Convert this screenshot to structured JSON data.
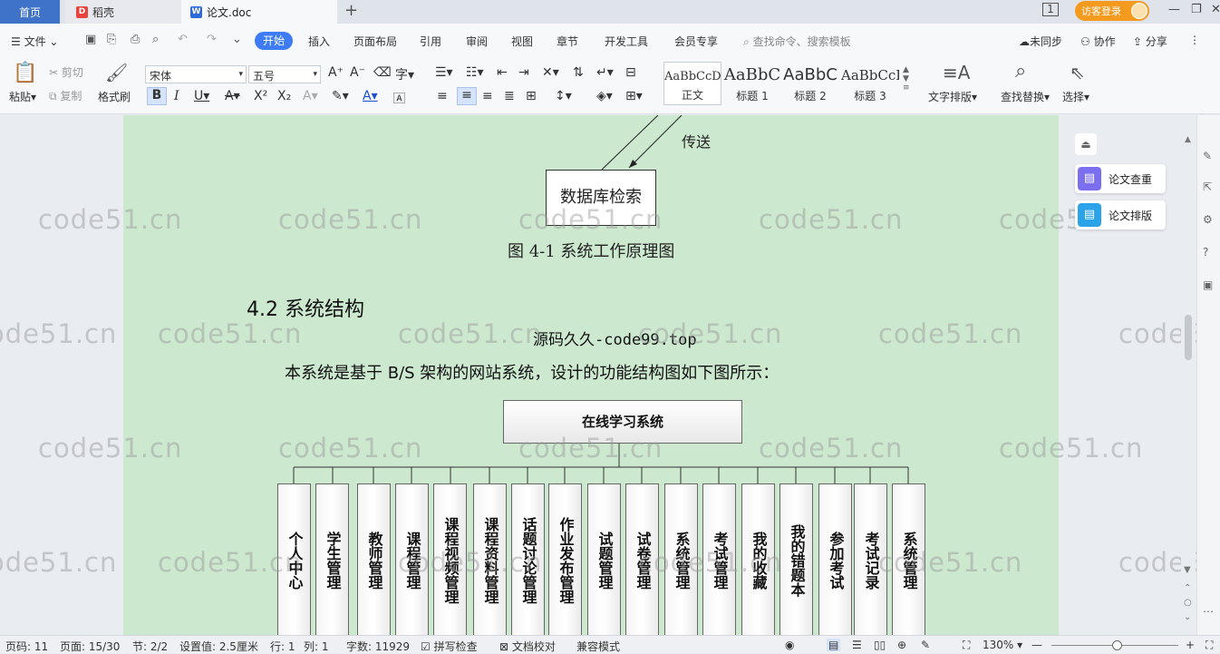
{
  "titlebar": {
    "tabs": [
      {
        "label": "首页"
      },
      {
        "label": "稻壳"
      },
      {
        "label": "论文.doc"
      }
    ],
    "login_label": "访客登录"
  },
  "menubar": {
    "file_label": "文件",
    "items": [
      "开始",
      "插入",
      "页面布局",
      "引用",
      "审阅",
      "视图",
      "章节",
      "开发工具",
      "会员专享"
    ],
    "search_placeholder": "查找命令、搜索模板",
    "sync_label": "未同步",
    "collab_label": "协作",
    "share_label": "分享"
  },
  "ribbon": {
    "paste_label": "粘贴",
    "cut_label": "剪切",
    "copy_label": "复制",
    "format_painter_label": "格式刷",
    "font_name": "宋体",
    "font_size": "五号",
    "styles": [
      {
        "preview": "AaBbCcDd",
        "label": "正文"
      },
      {
        "preview": "AaBbC",
        "label": "标题 1"
      },
      {
        "preview": "AaBbC",
        "label": "标题 2"
      },
      {
        "preview": "AaBbCcI",
        "label": "标题 3"
      }
    ],
    "text_layout_label": "文字排版",
    "find_replace_label": "查找替换",
    "select_label": "选择"
  },
  "document": {
    "transfer_label": "传送",
    "db_box_label": "数据库检索",
    "figure_caption": "图 4-1 系统工作原理图",
    "section_heading": "4.2 系统结构",
    "source_line": "源码久久-code99.top",
    "body_paragraph": "本系统是基于 B/S 架构的网站系统，设计的功能结构图如下图所示：",
    "root_module": "在线学习系统",
    "modules": [
      "个人中心",
      "学生管理",
      "教师管理",
      "课程管理",
      "课程视频管理",
      "课程资料管理",
      "话题讨论管理",
      "作业发布管理",
      "试题管理",
      "试卷管理",
      "系统管理",
      "考试管理",
      "我的收藏",
      "我的错题本",
      "参加考试",
      "考试记录",
      "系统管理"
    ],
    "watermark": "code51.cn"
  },
  "side_panels": [
    {
      "label": "论文查重",
      "color": "#7b6ff0"
    },
    {
      "label": "论文排版",
      "color": "#2aa3e8"
    }
  ],
  "statusbar": {
    "line_no": "页码: 11",
    "page": "页面: 15/30",
    "section": "节: 2/2",
    "setting": "设置值: 2.5厘米",
    "row": "行: 1",
    "col": "列: 1",
    "words": "字数: 11929",
    "spell_check": "拼写检查",
    "doc_proof": "文档校对",
    "compat": "兼容模式",
    "zoom": "130%"
  }
}
